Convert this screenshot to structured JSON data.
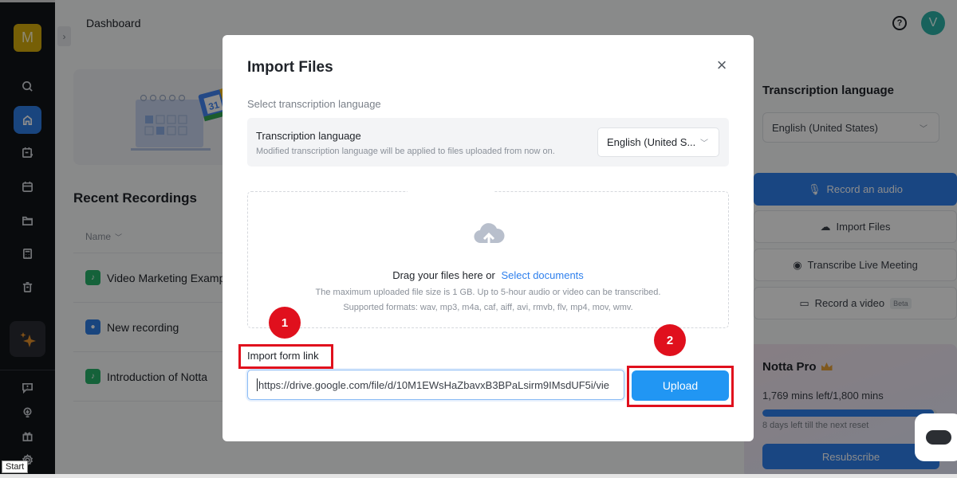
{
  "sidebar": {
    "logo_letter": "M",
    "items": [
      {
        "name": "search",
        "icon": "search-icon"
      },
      {
        "name": "home",
        "icon": "home-icon",
        "active": true
      },
      {
        "name": "calendar-add",
        "icon": "calendar-add-icon"
      },
      {
        "name": "calendar",
        "icon": "calendar-icon"
      },
      {
        "name": "folder",
        "icon": "folder-icon"
      },
      {
        "name": "calculator",
        "icon": "calculator-icon"
      },
      {
        "name": "trash",
        "icon": "trash-icon"
      },
      {
        "name": "ai-assistant",
        "icon": "sparkle-icon"
      },
      {
        "name": "feedback",
        "icon": "feedback-icon"
      },
      {
        "name": "tips",
        "icon": "lightbulb-icon"
      },
      {
        "name": "gift",
        "icon": "gift-icon"
      },
      {
        "name": "settings",
        "icon": "gear-icon"
      }
    ]
  },
  "header": {
    "title": "Dashboard",
    "help": "?",
    "avatar_letter": "V"
  },
  "recent": {
    "title": "Recent Recordings",
    "column_name": "Name",
    "rows": [
      {
        "name": "Video Marketing Example",
        "type": "video"
      },
      {
        "name": "New recording",
        "type": "audio"
      },
      {
        "name": "Introduction of Notta",
        "type": "video"
      }
    ]
  },
  "right_panel": {
    "title": "Transcription language",
    "language": "English (United States)",
    "actions": [
      {
        "label": "Record an audio",
        "icon": "microphone-icon",
        "primary": true
      },
      {
        "label": "Import Files",
        "icon": "cloud-upload-icon"
      },
      {
        "label": "Transcribe Live Meeting",
        "icon": "meeting-bot-icon"
      },
      {
        "label": "Record a video",
        "icon": "video-camera-icon",
        "badge": "Beta"
      }
    ],
    "pro": {
      "title": "Notta Pro",
      "mins": "1,769 mins left/1,800 mins",
      "usage_fraction": 0.983,
      "reset": "8 days left till the next reset",
      "button": "Resubscribe"
    }
  },
  "modal": {
    "title": "Import Files",
    "close": "×",
    "subtitle": "Select transcription language",
    "lang_label": "Transcription language",
    "lang_desc": "Modified transcription language will be applied to files uploaded from now on.",
    "lang_value": "English (United S...",
    "drop_text": "Drag your files here or",
    "drop_link": "Select documents",
    "drop_limit": "The maximum uploaded file size is 1 GB. Up to 5-hour audio or video can be transcribed.",
    "drop_formats": "Supported formats: wav, mp3, m4a, caf, aiff, avi, rmvb, flv, mp4, mov, wmv.",
    "import_label": "Import form link",
    "url_value": "https://drive.google.com/file/d/10M1EWsHaZbavxB3BPaLsirm9IMsdUF5i/vie",
    "upload_label": "Upload"
  },
  "annotations": {
    "step1": "1",
    "step2": "2"
  },
  "colors": {
    "accent": "#2f80ed",
    "annotation": "#e0101d",
    "sidebar_bg": "#111418",
    "logo": "#d8ae0c",
    "avatar": "#2db3a8"
  },
  "tooltip": "Start"
}
